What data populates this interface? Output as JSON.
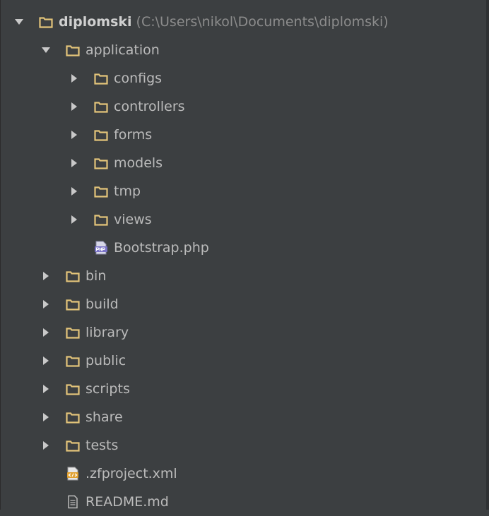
{
  "project_tree": {
    "root": {
      "name": "diplomski",
      "path": "(C:\\Users\\nikol\\Documents\\diplomski)",
      "expanded": true,
      "icon": "folder-icon"
    },
    "application": {
      "name": "application",
      "expanded": true,
      "icon": "folder-icon",
      "children": [
        {
          "name": "configs",
          "icon": "folder-icon",
          "expanded": false
        },
        {
          "name": "controllers",
          "icon": "folder-icon",
          "expanded": false
        },
        {
          "name": "forms",
          "icon": "folder-icon",
          "expanded": false
        },
        {
          "name": "models",
          "icon": "folder-icon",
          "expanded": false
        },
        {
          "name": "tmp",
          "icon": "folder-icon",
          "expanded": false
        },
        {
          "name": "views",
          "icon": "folder-icon",
          "expanded": false
        },
        {
          "name": "Bootstrap.php",
          "icon": "php-file-icon"
        }
      ]
    },
    "top_folders": [
      {
        "name": "bin",
        "icon": "folder-icon",
        "expanded": false
      },
      {
        "name": "build",
        "icon": "folder-icon",
        "expanded": false
      },
      {
        "name": "library",
        "icon": "folder-icon",
        "expanded": false
      },
      {
        "name": "public",
        "icon": "folder-icon",
        "expanded": false
      },
      {
        "name": "scripts",
        "icon": "folder-icon",
        "expanded": false
      },
      {
        "name": "share",
        "icon": "folder-icon",
        "expanded": false
      },
      {
        "name": "tests",
        "icon": "folder-icon",
        "expanded": false
      }
    ],
    "top_files": [
      {
        "name": ".zfproject.xml",
        "icon": "xml-file-icon"
      },
      {
        "name": "README.md",
        "icon": "text-file-icon"
      }
    ]
  },
  "colors": {
    "background": "#3c3f41",
    "text": "#bbbbbb",
    "path_text": "#8c8c8c",
    "folder": "#e3c47a",
    "arrow": "#c9c9c9"
  }
}
